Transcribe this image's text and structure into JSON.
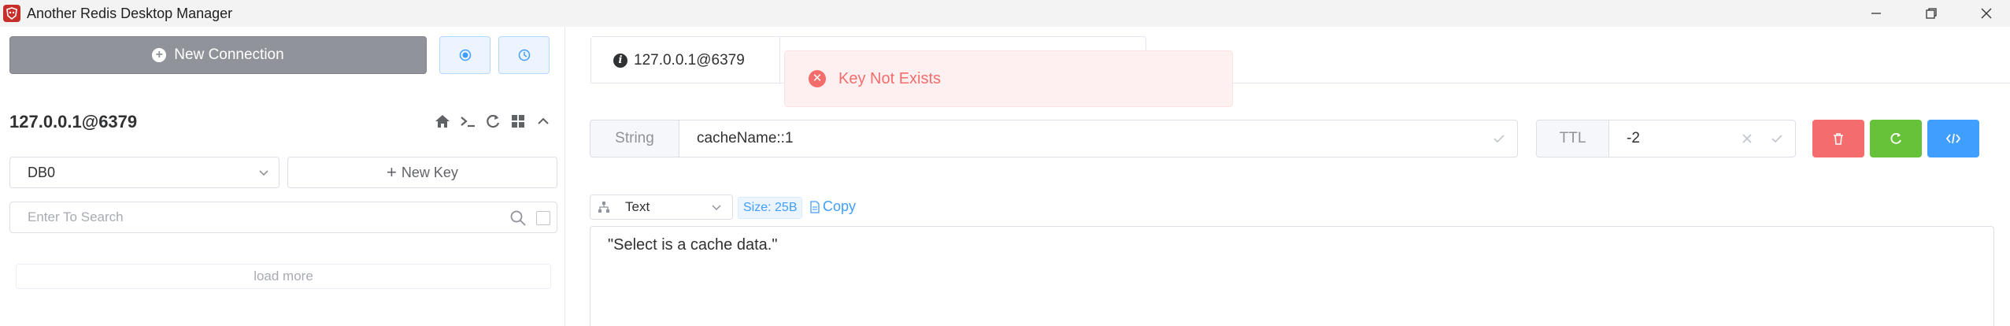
{
  "window": {
    "title": "Another Redis Desktop Manager"
  },
  "sidebar": {
    "new_connection_label": "New Connection",
    "connection_name": "127.0.0.1@6379",
    "db_selected": "DB0",
    "new_key_label": "New Key",
    "search_placeholder": "Enter To Search",
    "load_more_label": "load more"
  },
  "tabs": [
    {
      "label": "127.0.0.1@6379",
      "active": true
    }
  ],
  "notification": {
    "message": "Key Not Exists",
    "type": "error"
  },
  "key_editor": {
    "type_label": "String",
    "key_name": "cacheName::1",
    "ttl_label": "TTL",
    "ttl_value": "-2"
  },
  "value_viewer": {
    "format": "Text",
    "size_tag": "Size: 25B",
    "copy_label": "Copy",
    "content": "\"Select is a cache data.\""
  },
  "colors": {
    "danger": "#f56c6c",
    "success": "#67c23a",
    "primary": "#409eff",
    "neutral": "#909399"
  },
  "icons": [
    "app-logo-icon",
    "minimize-icon",
    "maximize-icon",
    "close-icon",
    "plus-icon",
    "status-dot-icon",
    "clock-icon",
    "home-icon",
    "terminal-icon",
    "refresh-icon",
    "grid-icon",
    "chevron-up-icon",
    "chevron-down-icon",
    "search-icon",
    "info-icon",
    "error-icon",
    "check-icon",
    "clear-icon",
    "delete-icon",
    "code-icon",
    "tree-icon",
    "document-icon"
  ]
}
